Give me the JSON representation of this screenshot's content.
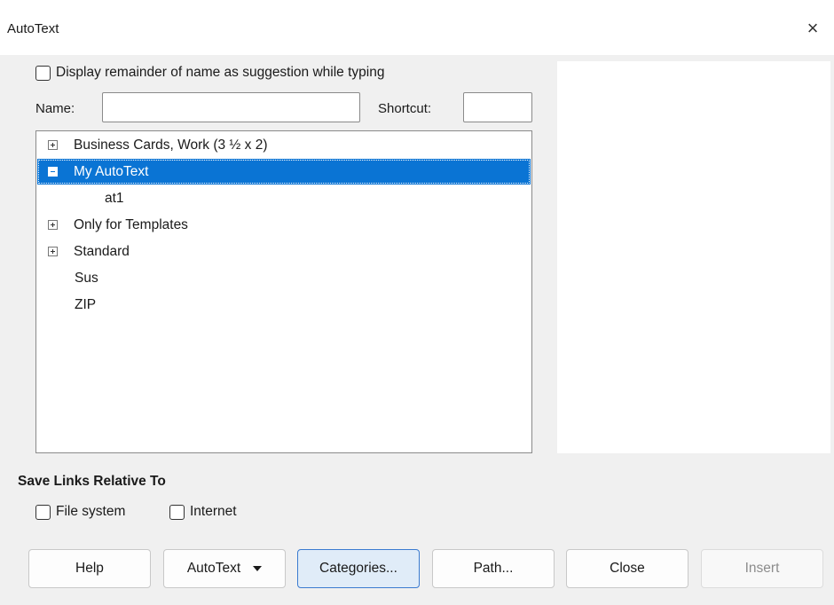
{
  "window": {
    "title": "AutoText",
    "close_glyph": "×"
  },
  "options": {
    "display_remainder": {
      "label": "Display remainder of name as suggestion while typing",
      "checked": false
    }
  },
  "fields": {
    "name_label": "Name:",
    "name_value": "",
    "shortcut_label": "Shortcut:",
    "shortcut_value": ""
  },
  "tree": {
    "items": [
      {
        "label": "Business Cards, Work (3 ½ x 2)",
        "expander": "plus",
        "level": 0,
        "selected": false
      },
      {
        "label": "My AutoText",
        "expander": "minus",
        "level": 0,
        "selected": true
      },
      {
        "label": "at1",
        "expander": "none",
        "level": 1,
        "selected": false
      },
      {
        "label": "Only for Templates",
        "expander": "plus",
        "level": 0,
        "selected": false
      },
      {
        "label": "Standard",
        "expander": "plus",
        "level": 0,
        "selected": false
      },
      {
        "label": "Sus",
        "expander": "none",
        "level": 0,
        "selected": false
      },
      {
        "label": "ZIP",
        "expander": "none",
        "level": 0,
        "selected": false
      }
    ]
  },
  "save_links": {
    "title": "Save Links Relative To",
    "file_system": {
      "label": "File system",
      "checked": false
    },
    "internet": {
      "label": "Internet",
      "checked": false
    }
  },
  "buttons": {
    "help": "Help",
    "autotext": "AutoText",
    "categories": "Categories...",
    "path": "Path...",
    "close": "Close",
    "insert": "Insert"
  },
  "colors": {
    "selection": "#0a74d4",
    "dialog_bg": "#f0f0f0"
  }
}
